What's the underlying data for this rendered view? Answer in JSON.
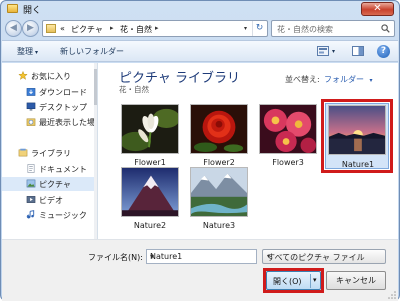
{
  "window": {
    "title": "開く",
    "close_glyph": "✕"
  },
  "address": {
    "back_glyph": "◀",
    "forward_glyph": "▶",
    "prefix": "«",
    "crumbs": [
      "ピクチャ",
      "花・自然"
    ],
    "separator": "▸",
    "dropdown_glyph": "▾",
    "refresh_glyph": "↻"
  },
  "search": {
    "placeholder": "花・自然の検索"
  },
  "toolbar": {
    "organize_label": "整理",
    "caret": "▾",
    "new_folder_label": "新しいフォルダー",
    "help_glyph": "?"
  },
  "nav": {
    "items": [
      {
        "label": "お気に入り",
        "icon": "star-icon"
      },
      {
        "label": "ダウンロード",
        "icon": "download-folder-icon"
      },
      {
        "label": "デスクトップ",
        "icon": "desktop-icon"
      },
      {
        "label": "最近表示した場所",
        "icon": "recent-places-icon"
      },
      {
        "label": "ライブラリ",
        "icon": "library-icon"
      },
      {
        "label": "ドキュメント",
        "icon": "documents-icon"
      },
      {
        "label": "ピクチャ",
        "icon": "pictures-icon"
      },
      {
        "label": "ビデオ",
        "icon": "video-icon"
      },
      {
        "label": "ミュージック",
        "icon": "music-icon"
      }
    ]
  },
  "library": {
    "title": "ピクチャ ライブラリ",
    "subtitle": "花・自然",
    "arrange_label": "並べ替え:",
    "arrange_value": "フォルダー",
    "arrange_caret": "▾"
  },
  "files": [
    {
      "name": "Flower1",
      "selected": false
    },
    {
      "name": "Flower2",
      "selected": false
    },
    {
      "name": "Flower3",
      "selected": false
    },
    {
      "name": "Nature1",
      "selected": true
    },
    {
      "name": "Nature2",
      "selected": false
    },
    {
      "name": "Nature3",
      "selected": false
    }
  ],
  "footer": {
    "filename_label": "ファイル名(N):",
    "filename_value": "Nature1",
    "filename_caret": "▾",
    "filetype_value": "すべてのピクチャ ファイル",
    "filetype_caret": "▾",
    "open_label": "開く(O)",
    "open_caret": "▾",
    "cancel_label": "キャンセル"
  },
  "colors": {
    "highlight": "#d01b1b",
    "accent": "#2a5db0",
    "title_blue": "#1e3b79",
    "selection": "#d3e4f8"
  }
}
